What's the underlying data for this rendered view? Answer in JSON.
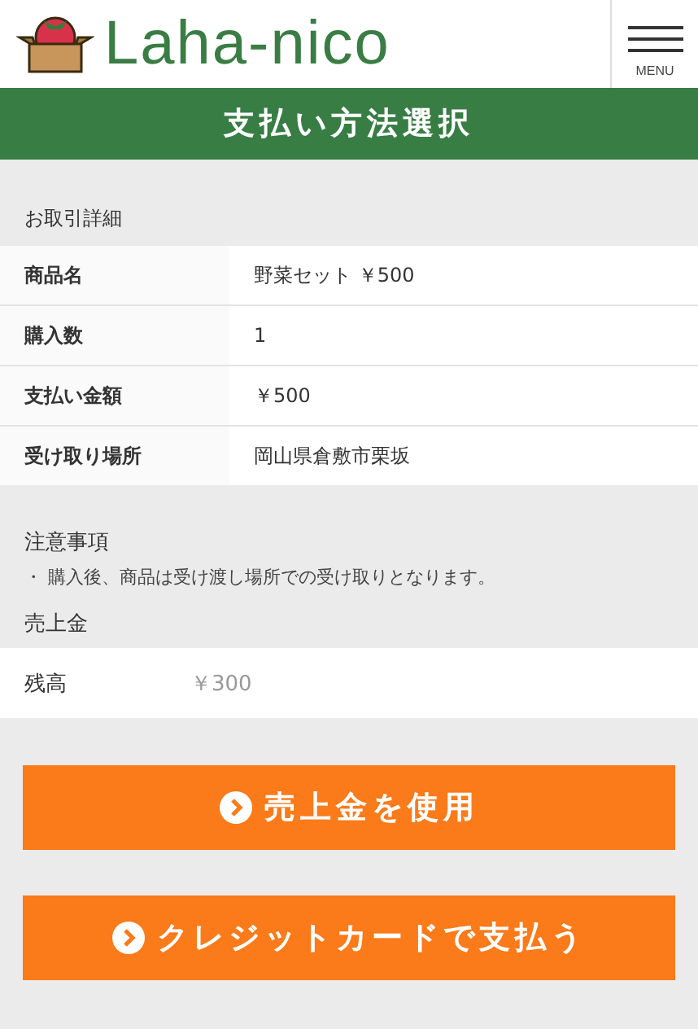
{
  "header": {
    "logo": "Laha-nico",
    "menu": "MENU"
  },
  "title": "支払い方法選択",
  "transaction": {
    "heading": "お取引詳細",
    "rows": [
      {
        "label": "商品名",
        "value": "野菜セット ￥500"
      },
      {
        "label": "購入数",
        "value": "1"
      },
      {
        "label": "支払い金額",
        "value": "￥500"
      },
      {
        "label": "受け取り場所",
        "value": "岡山県倉敷市栗坂"
      }
    ]
  },
  "notes": {
    "heading": "注意事項",
    "items": [
      "・ 購入後、商品は受け渡し場所での受け取りとなります。"
    ]
  },
  "sales": {
    "heading": "売上金",
    "label": "残高",
    "value": "￥300"
  },
  "buttons": [
    "売上金を使用",
    "クレジットカードで支払う"
  ]
}
